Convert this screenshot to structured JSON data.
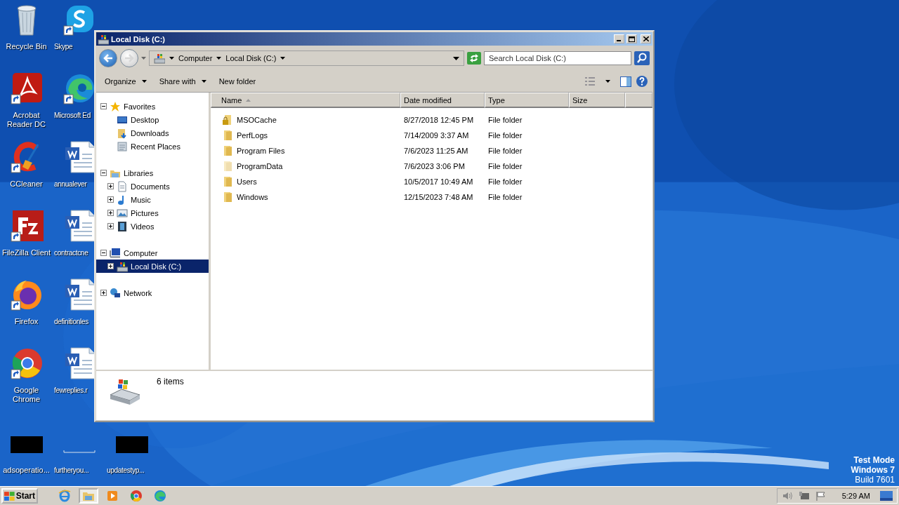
{
  "desktop_icons": [
    [
      {
        "label": "Recycle Bin",
        "kind": "recycle",
        "shortcut": false
      },
      {
        "label": "Acrobat Reader DC",
        "kind": "acrobat",
        "shortcut": true
      },
      {
        "label": "CCleaner",
        "kind": "ccleaner",
        "shortcut": true
      },
      {
        "label": "FileZilla Client",
        "kind": "filezilla",
        "shortcut": true
      },
      {
        "label": "Firefox",
        "kind": "firefox",
        "shortcut": true
      },
      {
        "label": "Google Chrome",
        "kind": "chrome",
        "shortcut": true
      },
      {
        "label": "adsoperatio...",
        "kind": "thumb",
        "shortcut": false
      }
    ],
    [
      {
        "label": "Skype",
        "kind": "skype",
        "shortcut": true
      },
      {
        "label": "Microsoft Ed",
        "kind": "edge",
        "shortcut": true
      },
      {
        "label": "annualever",
        "kind": "word",
        "shortcut": false
      },
      {
        "label": "contractcne",
        "kind": "word",
        "shortcut": false
      },
      {
        "label": "definitionles",
        "kind": "word",
        "shortcut": false
      },
      {
        "label": "fewreplies.r",
        "kind": "word",
        "shortcut": false
      },
      {
        "label": "furtheryou...",
        "kind": "blank",
        "shortcut": false
      }
    ],
    [
      {
        "label": "updatestyp...",
        "kind": "thumb",
        "shortcut": false
      }
    ]
  ],
  "window": {
    "title": "Local Disk (C:)",
    "address": {
      "crumbs": [
        "Computer",
        "Local Disk (C:)"
      ]
    },
    "search": {
      "placeholder": "Search Local Disk (C:)"
    },
    "toolbar": [
      {
        "label": "Organize",
        "menu": true
      },
      {
        "label": "Share with",
        "menu": true
      },
      {
        "label": "New folder",
        "menu": false
      }
    ],
    "nav": [
      {
        "label": "Favorites",
        "kind": "star",
        "expanded": true,
        "selected": false,
        "children": [
          {
            "label": "Desktop",
            "kind": "desktop",
            "selected": false
          },
          {
            "label": "Downloads",
            "kind": "downloads",
            "selected": false
          },
          {
            "label": "Recent Places",
            "kind": "recent",
            "selected": false
          }
        ]
      },
      {
        "label": "Libraries",
        "kind": "library",
        "expanded": true,
        "selected": false,
        "children": [
          {
            "label": "Documents",
            "kind": "documents",
            "expanded": false,
            "selected": false
          },
          {
            "label": "Music",
            "kind": "music",
            "expanded": false,
            "selected": false
          },
          {
            "label": "Pictures",
            "kind": "pictures",
            "expanded": false,
            "selected": false
          },
          {
            "label": "Videos",
            "kind": "videos",
            "expanded": false,
            "selected": false
          }
        ]
      },
      {
        "label": "Computer",
        "kind": "computer",
        "expanded": true,
        "selected": false,
        "children": [
          {
            "label": "Local Disk (C:)",
            "kind": "drive",
            "expanded": false,
            "selected": true
          }
        ]
      },
      {
        "label": "Network",
        "kind": "network",
        "expanded": false,
        "selected": false
      }
    ],
    "columns": [
      {
        "label": "Name",
        "sorted": true
      },
      {
        "label": "Date modified",
        "sorted": false
      },
      {
        "label": "Type",
        "sorted": false
      },
      {
        "label": "Size",
        "sorted": false
      }
    ],
    "files": [
      {
        "name": "MSOCache",
        "date": "8/27/2018 12:45 PM",
        "type": "File folder",
        "kind": "locked",
        "hidden": false
      },
      {
        "name": "PerfLogs",
        "date": "7/14/2009 3:37 AM",
        "type": "File folder",
        "kind": "folder",
        "hidden": false
      },
      {
        "name": "Program Files",
        "date": "7/6/2023 11:25 AM",
        "type": "File folder",
        "kind": "folder",
        "hidden": false
      },
      {
        "name": "ProgramData",
        "date": "7/6/2023 3:06 PM",
        "type": "File folder",
        "kind": "folder",
        "hidden": true
      },
      {
        "name": "Users",
        "date": "10/5/2017 10:49 AM",
        "type": "File folder",
        "kind": "folder",
        "hidden": false
      },
      {
        "name": "Windows",
        "date": "12/15/2023 7:48 AM",
        "type": "File folder",
        "kind": "folder",
        "hidden": false
      }
    ],
    "details": {
      "count": "6 items"
    }
  },
  "watermark_os": [
    "Test Mode",
    "Windows 7",
    "Build 7601"
  ],
  "taskbar": {
    "start": "Start",
    "apps": [
      {
        "kind": "ie",
        "selected": false
      },
      {
        "kind": "explorer",
        "selected": true
      },
      {
        "kind": "media",
        "selected": false
      },
      {
        "kind": "chrome",
        "selected": false
      },
      {
        "kind": "edge",
        "selected": false
      }
    ],
    "clock": "5:29 AM"
  }
}
